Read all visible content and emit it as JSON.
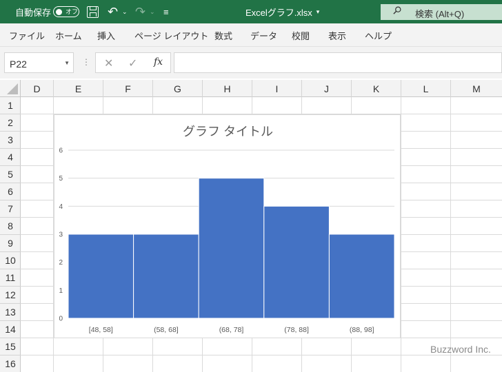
{
  "titlebar": {
    "autosave_label": "自動保存",
    "autosave_state": "オフ",
    "filename": "Excelグラフ.xlsx",
    "search_label": "検索 (Alt+Q)",
    "bg_color": "#217346"
  },
  "ribbon": {
    "tabs": [
      "ファイル",
      "ホーム",
      "挿入",
      "ページ レイアウト",
      "数式",
      "データ",
      "校閲",
      "表示",
      "ヘルプ"
    ]
  },
  "formula_bar": {
    "name_box": "P22",
    "fx_label": "fx",
    "formula": ""
  },
  "sheet": {
    "columns": [
      "D",
      "E",
      "F",
      "G",
      "H",
      "I",
      "J",
      "K",
      "L",
      "M"
    ],
    "rows": [
      "1",
      "2",
      "3",
      "4",
      "5",
      "6",
      "7",
      "8",
      "9",
      "10",
      "11",
      "12",
      "13",
      "14",
      "15",
      "16"
    ]
  },
  "watermark": "Buzzword Inc.",
  "chart_data": {
    "type": "bar",
    "title": "グラフ タイトル",
    "categories": [
      "[48, 58]",
      "(58, 68]",
      "(68, 78]",
      "(78, 88]",
      "(88, 98]"
    ],
    "values": [
      3,
      3,
      5,
      4,
      3
    ],
    "ylim": [
      0,
      6
    ],
    "yticks": [
      0,
      1,
      2,
      3,
      4,
      5,
      6
    ],
    "grid": true,
    "bar_color": "#4472C4",
    "xlabel": "",
    "ylabel": ""
  }
}
